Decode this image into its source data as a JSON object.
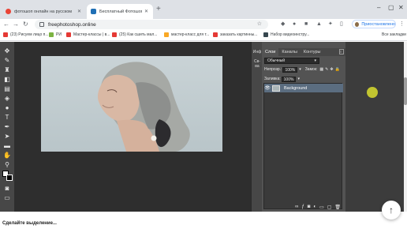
{
  "browser": {
    "tabs": [
      {
        "title": "фотошоп онлайн на русском ",
        "active": false
      },
      {
        "title": "Бесплатный Фотошоп Онлайн",
        "active": true
      }
    ],
    "new_tab_label": "+",
    "address": "freephotoshop.online",
    "profile_label": "Приостановлено",
    "bookmarks": [
      {
        "label": "(23) Рисуем лицо п..."
      },
      {
        "label": "РИ"
      },
      {
        "label": "Мастер-классы | в..."
      },
      {
        "label": "(25) Как сшить мал..."
      },
      {
        "label": "мастер-класс для т..."
      },
      {
        "label": "заказать картинны..."
      },
      {
        "label": "Набор видеоинстру..."
      }
    ],
    "all_bookmarks": "Все закладки"
  },
  "app": {
    "panel_strip": [
      "Инф",
      "Св-ва"
    ],
    "layers_panel": {
      "tabs": [
        "Слои",
        "Каналы",
        "Контуры"
      ],
      "blend_mode": "Обычный",
      "opacity_label": "Непрозр.:",
      "opacity_value": "100%",
      "lock_label": "Замок:",
      "fill_label": "Заливка:",
      "fill_value": "100%",
      "layers": [
        {
          "name": "Background"
        }
      ],
      "bottom_icons": [
        "link-icon",
        "fx-icon",
        "mask-icon",
        "adjust-icon",
        "folder-icon",
        "new-layer-icon",
        "trash-icon"
      ]
    },
    "tools": [
      "move-icon",
      "marquee-icon",
      "lasso-icon",
      "magic-wand-icon",
      "crop-icon",
      "eyedropper-icon",
      "brush-icon",
      "eraser-icon",
      "gradient-icon",
      "blur-icon",
      "dodge-icon",
      "type-icon",
      "pen-icon",
      "shape-icon",
      "hand-icon",
      "zoom-icon"
    ]
  },
  "page": {
    "bottom_text": "Сделайте выделение...",
    "fab": "↑"
  },
  "colors": {
    "accent": "#1a73e8",
    "app_bg": "#3c3c3c"
  }
}
